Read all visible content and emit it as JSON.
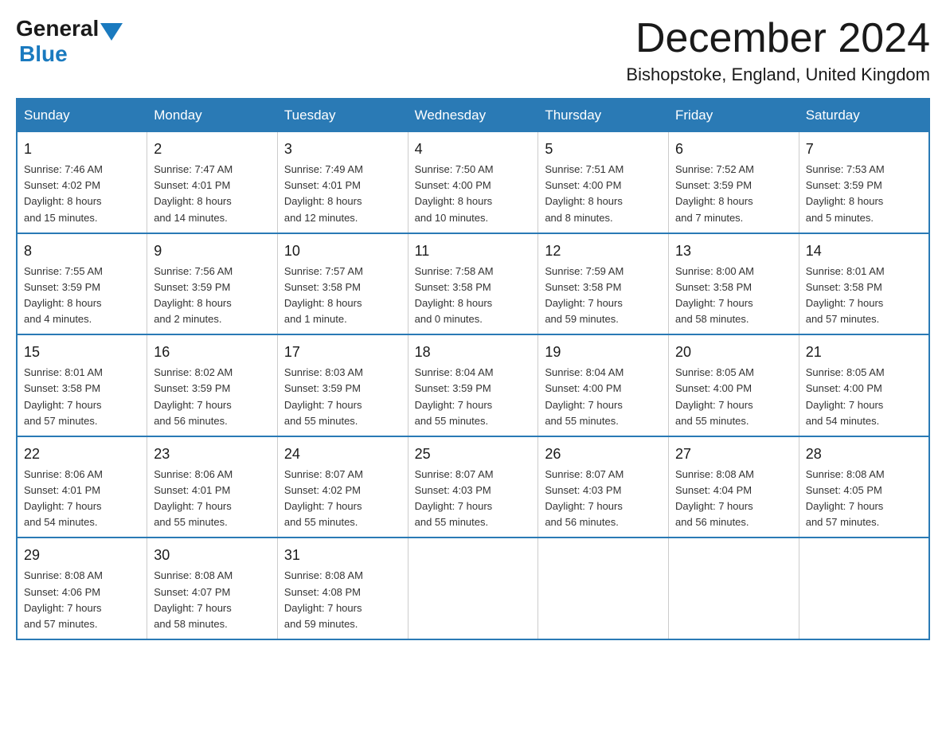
{
  "header": {
    "logo_general": "General",
    "logo_blue": "Blue",
    "month_title": "December 2024",
    "location": "Bishopstoke, England, United Kingdom"
  },
  "weekdays": [
    "Sunday",
    "Monday",
    "Tuesday",
    "Wednesday",
    "Thursday",
    "Friday",
    "Saturday"
  ],
  "weeks": [
    [
      {
        "day": "1",
        "info": "Sunrise: 7:46 AM\nSunset: 4:02 PM\nDaylight: 8 hours\nand 15 minutes."
      },
      {
        "day": "2",
        "info": "Sunrise: 7:47 AM\nSunset: 4:01 PM\nDaylight: 8 hours\nand 14 minutes."
      },
      {
        "day": "3",
        "info": "Sunrise: 7:49 AM\nSunset: 4:01 PM\nDaylight: 8 hours\nand 12 minutes."
      },
      {
        "day": "4",
        "info": "Sunrise: 7:50 AM\nSunset: 4:00 PM\nDaylight: 8 hours\nand 10 minutes."
      },
      {
        "day": "5",
        "info": "Sunrise: 7:51 AM\nSunset: 4:00 PM\nDaylight: 8 hours\nand 8 minutes."
      },
      {
        "day": "6",
        "info": "Sunrise: 7:52 AM\nSunset: 3:59 PM\nDaylight: 8 hours\nand 7 minutes."
      },
      {
        "day": "7",
        "info": "Sunrise: 7:53 AM\nSunset: 3:59 PM\nDaylight: 8 hours\nand 5 minutes."
      }
    ],
    [
      {
        "day": "8",
        "info": "Sunrise: 7:55 AM\nSunset: 3:59 PM\nDaylight: 8 hours\nand 4 minutes."
      },
      {
        "day": "9",
        "info": "Sunrise: 7:56 AM\nSunset: 3:59 PM\nDaylight: 8 hours\nand 2 minutes."
      },
      {
        "day": "10",
        "info": "Sunrise: 7:57 AM\nSunset: 3:58 PM\nDaylight: 8 hours\nand 1 minute."
      },
      {
        "day": "11",
        "info": "Sunrise: 7:58 AM\nSunset: 3:58 PM\nDaylight: 8 hours\nand 0 minutes."
      },
      {
        "day": "12",
        "info": "Sunrise: 7:59 AM\nSunset: 3:58 PM\nDaylight: 7 hours\nand 59 minutes."
      },
      {
        "day": "13",
        "info": "Sunrise: 8:00 AM\nSunset: 3:58 PM\nDaylight: 7 hours\nand 58 minutes."
      },
      {
        "day": "14",
        "info": "Sunrise: 8:01 AM\nSunset: 3:58 PM\nDaylight: 7 hours\nand 57 minutes."
      }
    ],
    [
      {
        "day": "15",
        "info": "Sunrise: 8:01 AM\nSunset: 3:58 PM\nDaylight: 7 hours\nand 57 minutes."
      },
      {
        "day": "16",
        "info": "Sunrise: 8:02 AM\nSunset: 3:59 PM\nDaylight: 7 hours\nand 56 minutes."
      },
      {
        "day": "17",
        "info": "Sunrise: 8:03 AM\nSunset: 3:59 PM\nDaylight: 7 hours\nand 55 minutes."
      },
      {
        "day": "18",
        "info": "Sunrise: 8:04 AM\nSunset: 3:59 PM\nDaylight: 7 hours\nand 55 minutes."
      },
      {
        "day": "19",
        "info": "Sunrise: 8:04 AM\nSunset: 4:00 PM\nDaylight: 7 hours\nand 55 minutes."
      },
      {
        "day": "20",
        "info": "Sunrise: 8:05 AM\nSunset: 4:00 PM\nDaylight: 7 hours\nand 55 minutes."
      },
      {
        "day": "21",
        "info": "Sunrise: 8:05 AM\nSunset: 4:00 PM\nDaylight: 7 hours\nand 54 minutes."
      }
    ],
    [
      {
        "day": "22",
        "info": "Sunrise: 8:06 AM\nSunset: 4:01 PM\nDaylight: 7 hours\nand 54 minutes."
      },
      {
        "day": "23",
        "info": "Sunrise: 8:06 AM\nSunset: 4:01 PM\nDaylight: 7 hours\nand 55 minutes."
      },
      {
        "day": "24",
        "info": "Sunrise: 8:07 AM\nSunset: 4:02 PM\nDaylight: 7 hours\nand 55 minutes."
      },
      {
        "day": "25",
        "info": "Sunrise: 8:07 AM\nSunset: 4:03 PM\nDaylight: 7 hours\nand 55 minutes."
      },
      {
        "day": "26",
        "info": "Sunrise: 8:07 AM\nSunset: 4:03 PM\nDaylight: 7 hours\nand 56 minutes."
      },
      {
        "day": "27",
        "info": "Sunrise: 8:08 AM\nSunset: 4:04 PM\nDaylight: 7 hours\nand 56 minutes."
      },
      {
        "day": "28",
        "info": "Sunrise: 8:08 AM\nSunset: 4:05 PM\nDaylight: 7 hours\nand 57 minutes."
      }
    ],
    [
      {
        "day": "29",
        "info": "Sunrise: 8:08 AM\nSunset: 4:06 PM\nDaylight: 7 hours\nand 57 minutes."
      },
      {
        "day": "30",
        "info": "Sunrise: 8:08 AM\nSunset: 4:07 PM\nDaylight: 7 hours\nand 58 minutes."
      },
      {
        "day": "31",
        "info": "Sunrise: 8:08 AM\nSunset: 4:08 PM\nDaylight: 7 hours\nand 59 minutes."
      },
      {
        "day": "",
        "info": ""
      },
      {
        "day": "",
        "info": ""
      },
      {
        "day": "",
        "info": ""
      },
      {
        "day": "",
        "info": ""
      }
    ]
  ]
}
